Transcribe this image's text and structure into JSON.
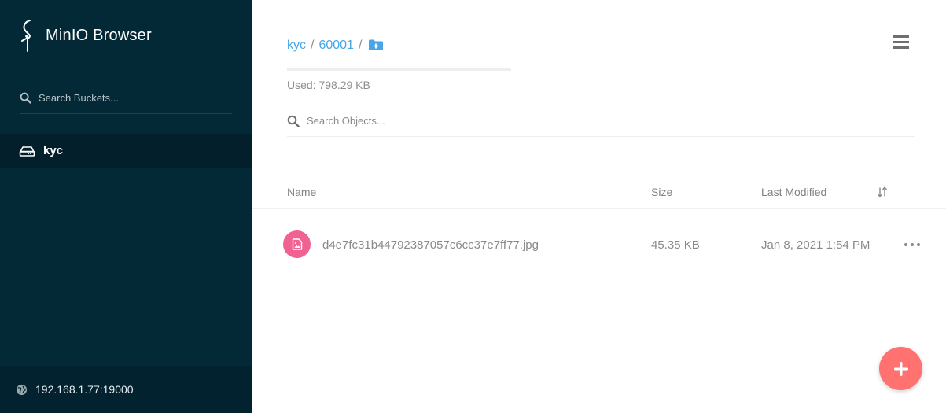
{
  "sidebar": {
    "brand": "MinIO Browser",
    "search_placeholder": "Search Buckets...",
    "buckets": [
      {
        "label": "kyc",
        "icon": "drive-icon",
        "active": true
      }
    ],
    "host": "192.168.1.77:19000",
    "host_icon": "globe-icon"
  },
  "main": {
    "breadcrumb": [
      "kyc",
      "60001"
    ],
    "breadcrumb_separator": "/",
    "usage": {
      "used_text": "Used: 798.29 KB",
      "fill_fraction": 0
    },
    "search_placeholder": "Search Objects...",
    "columns": {
      "name": "Name",
      "size": "Size",
      "modified": "Last Modified"
    },
    "rows": [
      {
        "name": "d4e7fc31b44792387057c6cc37e7ff77.jpg",
        "size": "45.35 KB",
        "modified": "Jan 8, 2021 1:54 PM",
        "icon": "image-file-icon"
      }
    ]
  },
  "colors": {
    "sidebar_bg": "#032836",
    "accent_link": "#46a6e6",
    "file_icon": "#f06292",
    "fab": "#ff726f"
  }
}
